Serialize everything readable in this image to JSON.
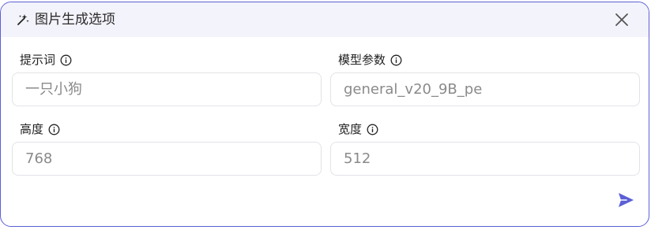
{
  "dialog": {
    "title": "图片生成选项",
    "icon": "wand-sparkle-icon",
    "close_icon": "close-icon",
    "accent_color": "#5b5fd6"
  },
  "fields": {
    "prompt": {
      "label": "提示词",
      "value": "一只小狗"
    },
    "model": {
      "label": "模型参数",
      "value": "general_v20_9B_pe"
    },
    "height": {
      "label": "高度",
      "value": "768"
    },
    "width": {
      "label": "宽度",
      "value": "512"
    }
  },
  "actions": {
    "send_icon": "send-icon"
  }
}
